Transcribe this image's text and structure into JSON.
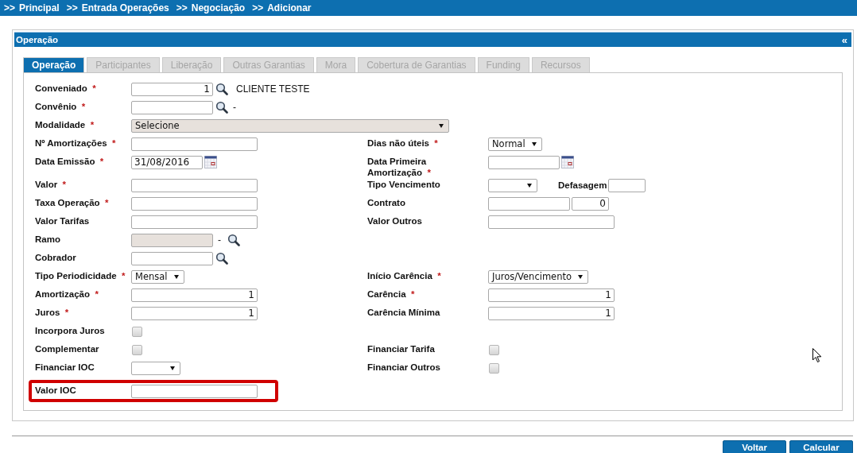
{
  "breadcrumb": [
    {
      "separator": ">>",
      "label": "Principal"
    },
    {
      "separator": ">>",
      "label": "Entrada Operações"
    },
    {
      "separator": ">>",
      "label": "Negociação"
    },
    {
      "separator": ">>",
      "label": "Adicionar"
    }
  ],
  "panel": {
    "title": "Operação",
    "collapse": "«"
  },
  "tabs": [
    {
      "label": "Operação",
      "selected": true
    },
    {
      "label": "Participantes",
      "selected": false
    },
    {
      "label": "Liberação",
      "selected": false
    },
    {
      "label": "Outras Garantias",
      "selected": false
    },
    {
      "label": "Mora",
      "selected": false
    },
    {
      "label": "Cobertura de Garantias",
      "selected": false
    },
    {
      "label": "Funding",
      "selected": false
    },
    {
      "label": "Recursos",
      "selected": false
    }
  ],
  "rows": [
    {
      "left": {
        "label": "Conveniado",
        "asterisk": "*",
        "kind": "lookup",
        "value": "1",
        "numeric": true,
        "description": "CLIENTE TESTE"
      }
    },
    {
      "left": {
        "label": "Convênio",
        "asterisk": "*",
        "kind": "lookup",
        "description": "-"
      }
    },
    {
      "left": {
        "label": "Modalidade",
        "asterisk": "*",
        "kind": "wide-select",
        "value": "Selecione"
      }
    },
    {
      "left": {
        "label": "Nº Amortizações",
        "asterisk": "*",
        "kind": "text"
      },
      "right": {
        "label": "Dias não úteis",
        "asterisk": "*",
        "kind": "select",
        "value": "Normal"
      }
    },
    {
      "left": {
        "label": "Data Emissão",
        "asterisk": "*",
        "kind": "date",
        "value": "31/08/2016"
      },
      "right": {
        "label": "Data Primeira Amortização",
        "asterisk": "*",
        "kind": "date"
      }
    },
    {
      "left": {
        "label": "Valor",
        "asterisk": "*",
        "kind": "text"
      },
      "right": {
        "label": "Tipo Vencimento",
        "kind": "select",
        "extra": {
          "label": "Defasagem"
        }
      }
    },
    {
      "left": {
        "label": "Taxa Operação",
        "asterisk": "*",
        "kind": "text"
      },
      "right": {
        "label": "Contrato",
        "kind": "text-pair",
        "second_value": "0"
      }
    },
    {
      "left": {
        "label": "Valor Tarifas",
        "kind": "text"
      },
      "right": {
        "label": "Valor Outros",
        "kind": "text"
      }
    },
    {
      "left": {
        "label": "Ramo",
        "kind": "locked-lookup",
        "description": "-"
      }
    },
    {
      "left": {
        "label": "Cobrador",
        "kind": "lookup"
      }
    },
    {
      "left": {
        "label": "Tipo Periodicidade",
        "asterisk": "*",
        "kind": "select",
        "value": "Mensal"
      },
      "right": {
        "label": "Início Carência",
        "asterisk": "*",
        "kind": "select",
        "value": "Juros/Vencimento"
      }
    },
    {
      "left": {
        "label": "Amortização",
        "asterisk": "*",
        "kind": "text",
        "value": "1",
        "numeric": true
      },
      "right": {
        "label": "Carência",
        "asterisk": "*",
        "kind": "text",
        "value": "1",
        "numeric": true
      }
    },
    {
      "left": {
        "label": "Juros",
        "asterisk": "*",
        "kind": "text",
        "value": "1",
        "numeric": true
      },
      "right": {
        "label": "Carência Mínima",
        "kind": "text",
        "value": "1",
        "numeric": true
      }
    },
    {
      "left": {
        "label": "Incorpora Juros",
        "kind": "checkbox",
        "checked": false
      }
    },
    {
      "left": {
        "label": "Complementar",
        "kind": "checkbox",
        "checked": false
      },
      "right": {
        "label": "Financiar Tarifa",
        "kind": "checkbox",
        "checked": false
      }
    },
    {
      "left": {
        "label": "Financiar IOC",
        "kind": "select"
      },
      "right": {
        "label": "Financiar Outros",
        "kind": "checkbox",
        "checked": false
      }
    },
    {
      "left": {
        "label": "Valor IOC",
        "kind": "text",
        "highlighted": true
      }
    }
  ],
  "buttons": [
    "Voltar",
    "Calcular"
  ]
}
